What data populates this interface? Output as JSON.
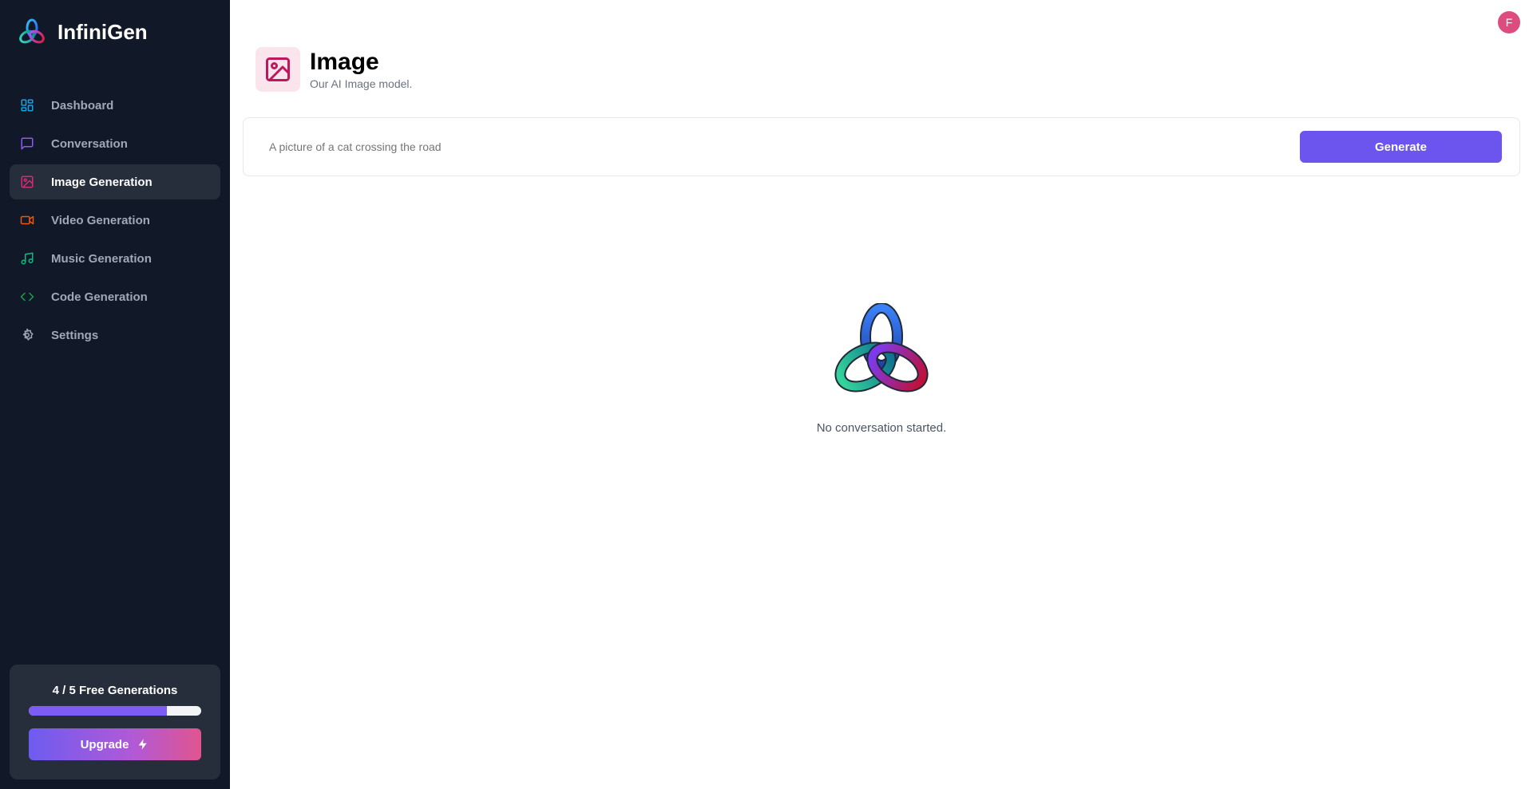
{
  "brand": {
    "name": "InfiniGen",
    "logo_icon": "knot-logo-icon"
  },
  "sidebar": {
    "items": [
      {
        "label": "Dashboard",
        "icon": "dashboard-icon",
        "color": "#0ea5e9",
        "active": false
      },
      {
        "label": "Conversation",
        "icon": "message-square-icon",
        "color": "#8b5cf6",
        "active": false
      },
      {
        "label": "Image Generation",
        "icon": "image-icon",
        "color": "#db2777",
        "active": true
      },
      {
        "label": "Video Generation",
        "icon": "video-icon",
        "color": "#ea580c",
        "active": false
      },
      {
        "label": "Music Generation",
        "icon": "music-icon",
        "color": "#10b981",
        "active": false
      },
      {
        "label": "Code Generation",
        "icon": "code-icon",
        "color": "#16a34a",
        "active": false
      },
      {
        "label": "Settings",
        "icon": "gear-icon",
        "color": "#a1a8b5",
        "active": false
      }
    ]
  },
  "plan": {
    "count_label": "4 / 5 Free Generations",
    "used": 4,
    "limit": 5,
    "progress_fraction": 0.8,
    "upgrade_label": "Upgrade",
    "upgrade_icon": "zap-icon"
  },
  "user": {
    "avatar_initial": "F",
    "avatar_color": "#dd4c7e"
  },
  "header": {
    "title": "Image",
    "subtitle": "Our AI Image model.",
    "icon": "image-icon",
    "icon_color": "#be185d",
    "icon_bg": "#fbe5ec"
  },
  "prompt": {
    "placeholder": "A picture of a cat crossing the road",
    "value": "",
    "generate_label": "Generate",
    "accent": "#6b55ee"
  },
  "empty_state": {
    "message": "No conversation started.",
    "icon": "knot-logo-icon"
  }
}
